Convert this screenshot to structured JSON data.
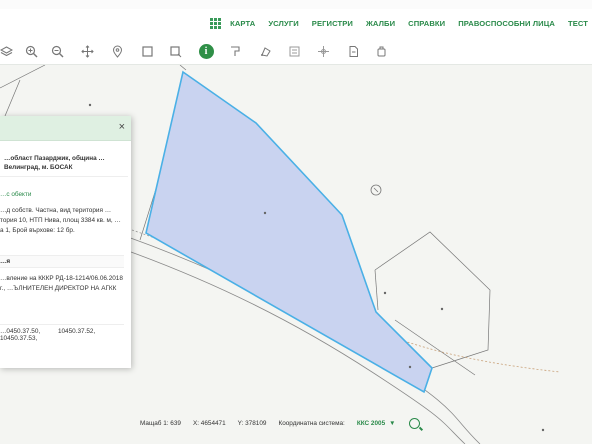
{
  "nav": {
    "items": [
      "КАРТА",
      "УСЛУГИ",
      "РЕГИСТРИ",
      "ЖАЛБИ",
      "СПРАВКИ",
      "ПРАВОСПОСОБНИ ЛИЦА",
      "ТЕСТ"
    ]
  },
  "toolbar": {
    "tools": [
      "layers-icon",
      "zoom-in-icon",
      "zoom-out-icon",
      "pan-icon",
      "location-pin-icon",
      "select-rect-icon",
      "select-area-icon",
      "info-icon",
      "measure-length-icon",
      "measure-area-icon",
      "print-icon",
      "export-icon",
      "document-icon",
      "settings-icon"
    ],
    "active_tool_glyph": "i"
  },
  "panel": {
    "close_glyph": "×",
    "address": "…област Пазарджик, община …Велинград, м. БОСАК",
    "link": "…с обекти",
    "description": "…д собств. Частна, вид територия …тория 10, НТП Нива, площ 3384 кв. м, …а 1, Брой върхове: 12 бр.",
    "section": "…я",
    "order": "…вление на КККР РД-18-1214/06.06.2018 г., …ЪЛНИТЕЛЕН ДИРЕКТОР НА АГКК",
    "neighbors": [
      "…0450.37.50,",
      "10450.37.52,",
      "10450.37.53,"
    ]
  },
  "status": {
    "scale": "Мащаб 1: 639",
    "x": "X: 4654471",
    "y": "Y: 378109",
    "crs_label": "Координатна система:",
    "crs_value": "ККС 2005",
    "crs_arrow": "▼"
  },
  "map": {
    "parcel_fill": "#c9d3f0",
    "parcel_stroke": "#4ab0e6",
    "boundary_color": "#777777"
  }
}
